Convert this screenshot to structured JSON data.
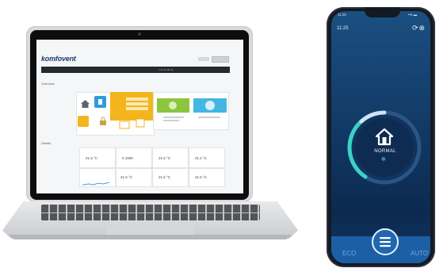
{
  "laptop": {
    "brand": "komfovent",
    "nav_label": "• •• •• ••• ••",
    "section_overview": "Overview",
    "section_details": "Details",
    "stats": [
      "21.6 °C",
      "0 1000",
      "21.6 °C",
      "21.2 °C",
      "21.6 °C",
      "21.6 °C",
      "21.6 °C"
    ]
  },
  "phone": {
    "status_time": "11:25",
    "status_icons": "••ıl ▬",
    "time": "11:25",
    "top_icons": "⟳⊗",
    "mode": "NORMAL",
    "fan_icon": "fan-icon",
    "eco_label": "ECO",
    "auto_label": "AUTO",
    "ring_colors": {
      "track": "#2a5584",
      "arc_left": "#3ad2c4",
      "arc_top": "#cfe3f6"
    }
  }
}
